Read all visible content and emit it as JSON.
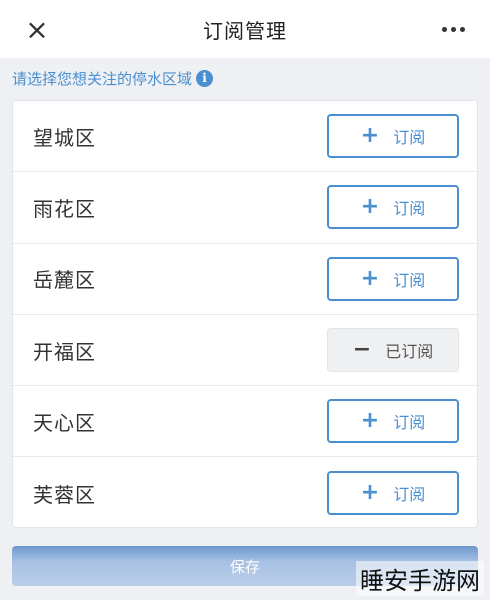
{
  "header": {
    "title": "订阅管理",
    "close_icon": "×"
  },
  "hint": {
    "text": "请选择您想关注的停水区域",
    "info_icon": "i"
  },
  "districts": [
    {
      "name": "望城区",
      "action": "订阅",
      "symbol": "+",
      "subscribed": false
    },
    {
      "name": "雨花区",
      "action": "订阅",
      "symbol": "+",
      "subscribed": false
    },
    {
      "name": "岳麓区",
      "action": "订阅",
      "symbol": "+",
      "subscribed": false
    },
    {
      "name": "开福区",
      "action": "已订阅",
      "symbol": "−",
      "subscribed": true
    },
    {
      "name": "天心区",
      "action": "订阅",
      "symbol": "+",
      "subscribed": false
    },
    {
      "name": "芙蓉区",
      "action": "订阅",
      "symbol": "+",
      "subscribed": false
    }
  ],
  "footer": {
    "save_label": "保存"
  },
  "watermark": "睡安手游网",
  "colors": {
    "accent": "#4a8fd0",
    "subscribed_bg": "#eef0f2"
  }
}
